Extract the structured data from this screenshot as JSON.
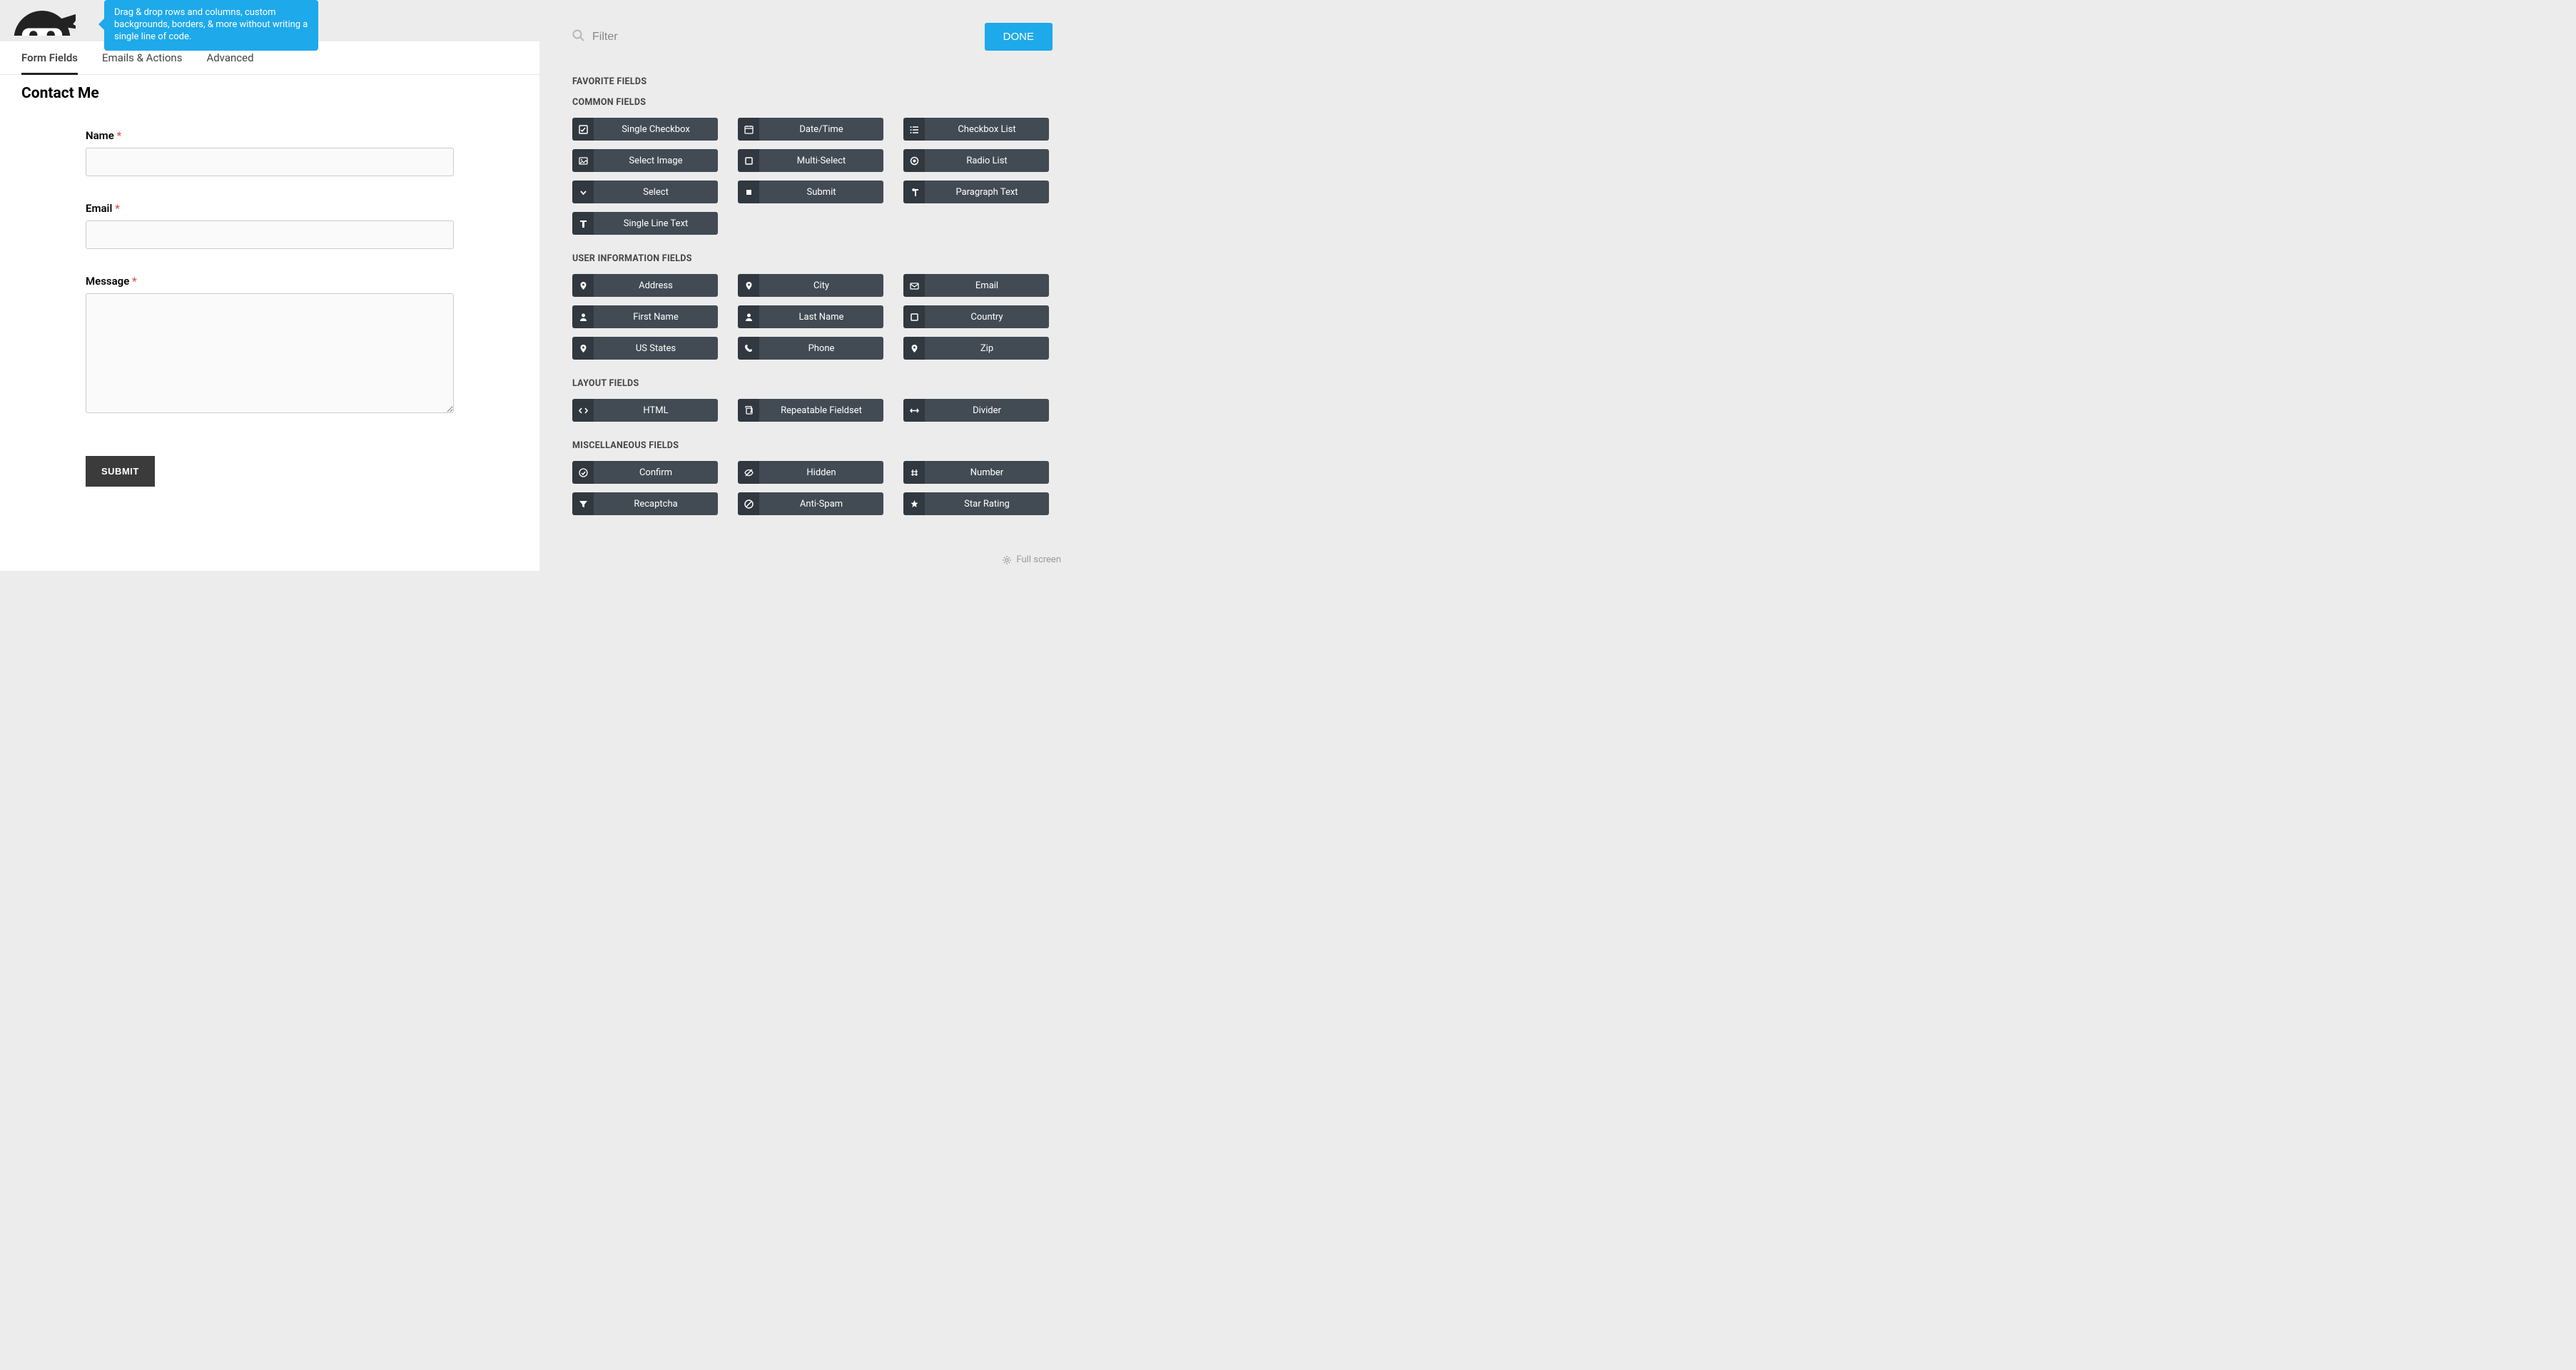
{
  "tooltip": "Drag & drop rows and columns, custom backgrounds, borders, & more without writing a single line of code.",
  "tabs": [
    {
      "label": "Form Fields",
      "active": true
    },
    {
      "label": "Emails & Actions",
      "active": false
    },
    {
      "label": "Advanced",
      "active": false
    }
  ],
  "form": {
    "title": "Contact Me",
    "fields": [
      {
        "label": "Name",
        "required": true,
        "type": "text"
      },
      {
        "label": "Email",
        "required": true,
        "type": "text"
      },
      {
        "label": "Message",
        "required": true,
        "type": "textarea"
      }
    ],
    "submit_label": "SUBMIT"
  },
  "panel": {
    "filter_placeholder": "Filter",
    "done_label": "DONE",
    "sections": [
      {
        "title": "FAVORITE FIELDS",
        "items": []
      },
      {
        "title": "COMMON FIELDS",
        "items": [
          {
            "label": "Single Checkbox",
            "icon": "checkbox"
          },
          {
            "label": "Date/Time",
            "icon": "calendar"
          },
          {
            "label": "Checkbox List",
            "icon": "list"
          },
          {
            "label": "Select Image",
            "icon": "image"
          },
          {
            "label": "Multi-Select",
            "icon": "square"
          },
          {
            "label": "Radio List",
            "icon": "radio"
          },
          {
            "label": "Select",
            "icon": "chevron"
          },
          {
            "label": "Submit",
            "icon": "square-fill"
          },
          {
            "label": "Paragraph Text",
            "icon": "paragraph"
          },
          {
            "label": "Single Line Text",
            "icon": "text"
          }
        ]
      },
      {
        "title": "USER INFORMATION FIELDS",
        "items": [
          {
            "label": "Address",
            "icon": "pin"
          },
          {
            "label": "City",
            "icon": "pin"
          },
          {
            "label": "Email",
            "icon": "envelope"
          },
          {
            "label": "First Name",
            "icon": "user"
          },
          {
            "label": "Last Name",
            "icon": "user"
          },
          {
            "label": "Country",
            "icon": "square"
          },
          {
            "label": "US States",
            "icon": "pin"
          },
          {
            "label": "Phone",
            "icon": "phone"
          },
          {
            "label": "Zip",
            "icon": "pin"
          }
        ]
      },
      {
        "title": "LAYOUT FIELDS",
        "items": [
          {
            "label": "HTML",
            "icon": "code"
          },
          {
            "label": "Repeatable Fieldset",
            "icon": "copy"
          },
          {
            "label": "Divider",
            "icon": "arrows"
          }
        ]
      },
      {
        "title": "MISCELLANEOUS FIELDS",
        "items": [
          {
            "label": "Confirm",
            "icon": "check-circle"
          },
          {
            "label": "Hidden",
            "icon": "eye-off"
          },
          {
            "label": "Number",
            "icon": "hash"
          },
          {
            "label": "Recaptcha",
            "icon": "filter"
          },
          {
            "label": "Anti-Spam",
            "icon": "ban"
          },
          {
            "label": "Star Rating",
            "icon": "star"
          }
        ]
      }
    ]
  },
  "footer": {
    "fullscreen_label": "Full screen"
  }
}
